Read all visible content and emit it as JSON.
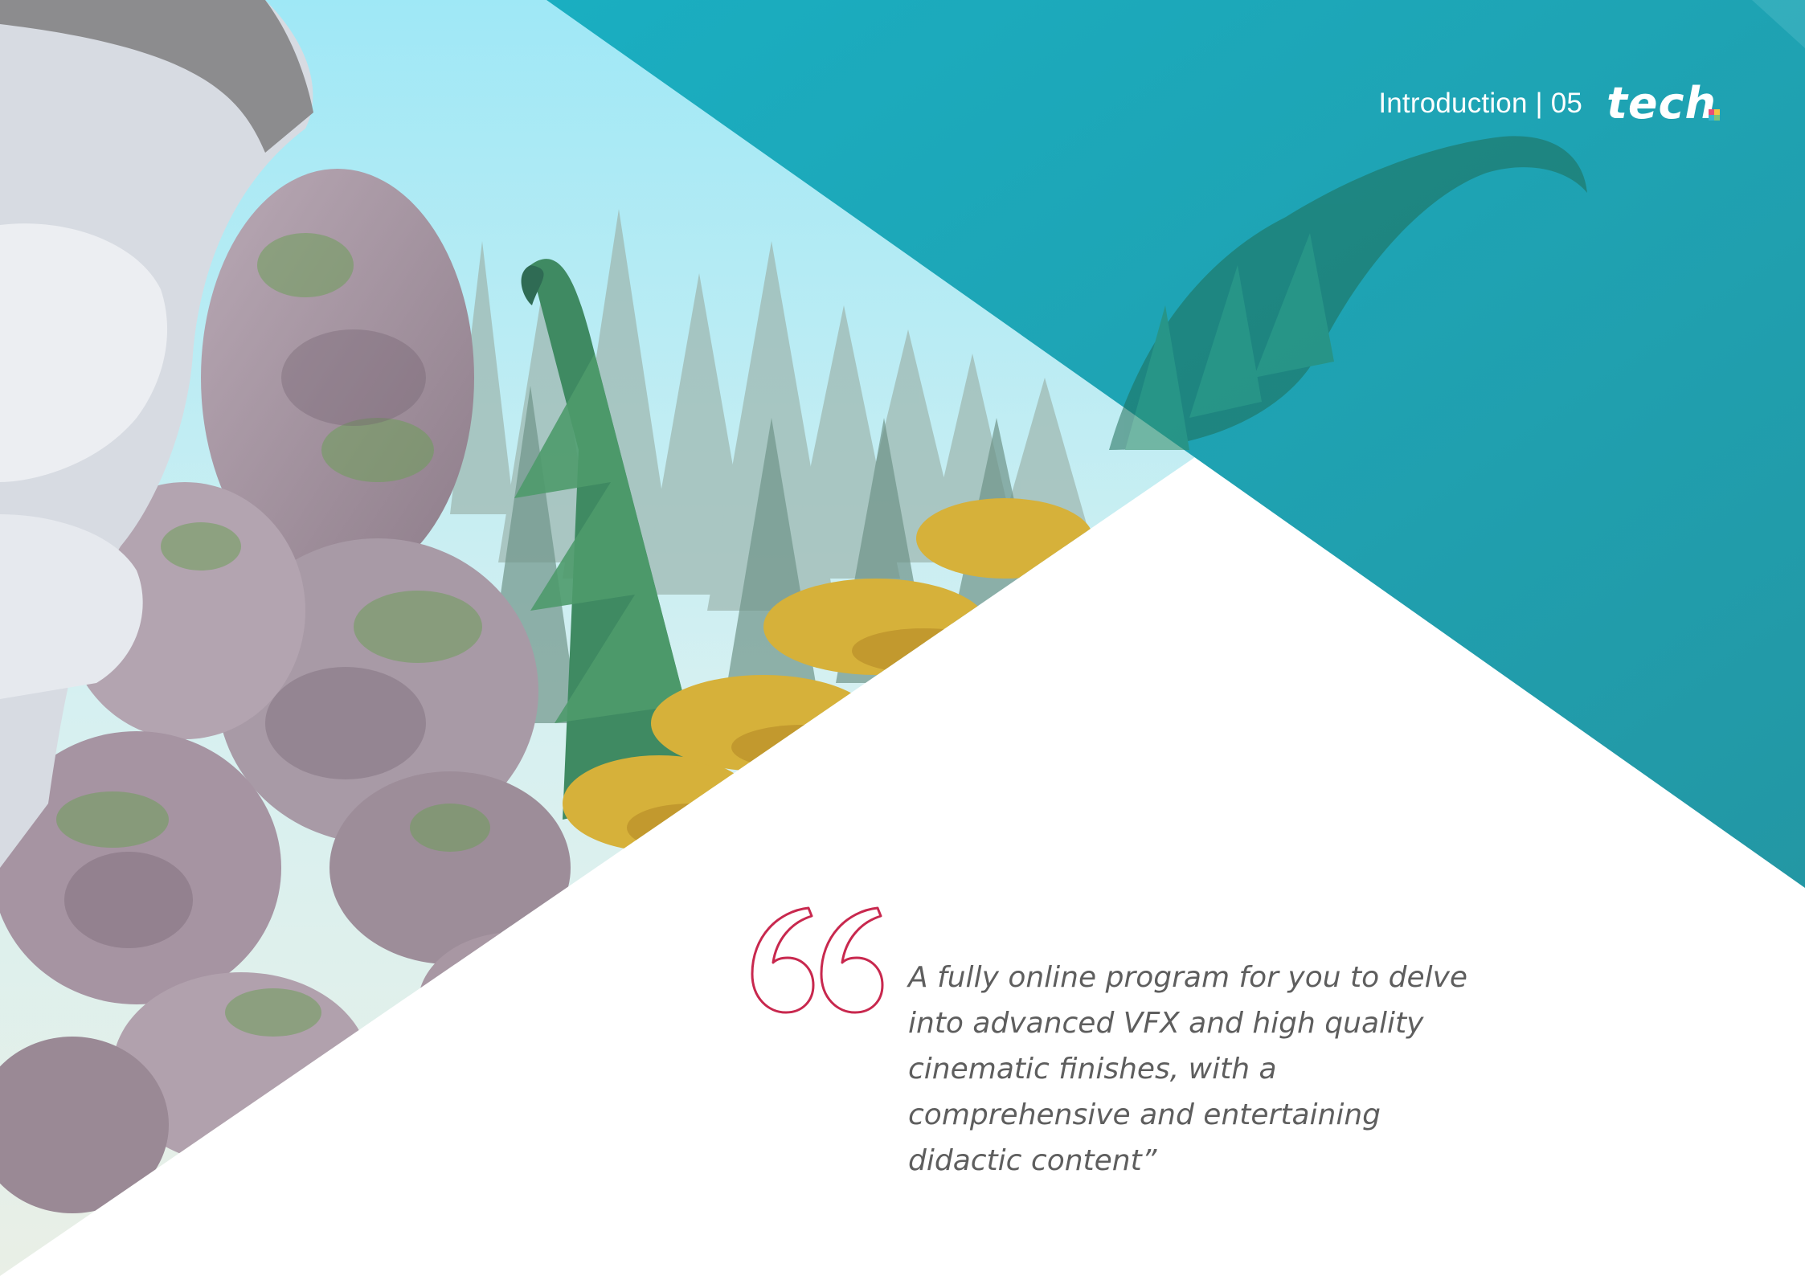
{
  "header": {
    "section_label": "Introduction | 05",
    "logo_text": "tech"
  },
  "quote": {
    "text": "A fully online program for you to delve into advanced VFX and high quality cinematic finishes, with a comprehensive and entertaining didactic content”"
  },
  "colors": {
    "teal": "#1fa6b4",
    "accent_crimson": "#c8284e",
    "text_gray": "#5e5e5e",
    "background": "#ffffff"
  },
  "icons": {
    "quote": "opening-quote-icon",
    "logo_mark": "tech-logo-mark-icon"
  }
}
